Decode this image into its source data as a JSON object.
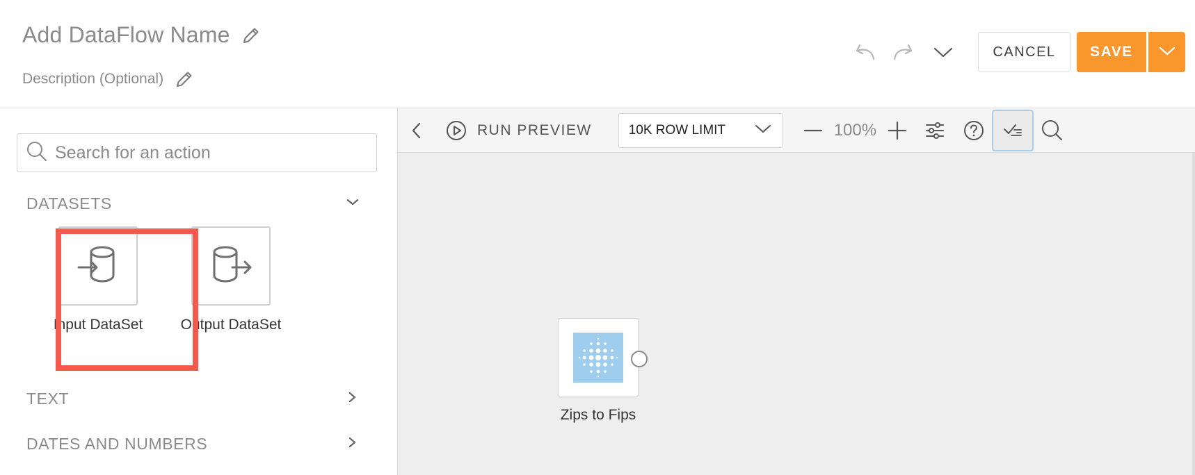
{
  "header": {
    "title": "Add DataFlow Name",
    "description": "Description (Optional)",
    "cancel_label": "CANCEL",
    "save_label": "SAVE"
  },
  "sidebar": {
    "search_placeholder": "Search for an action",
    "sections": [
      {
        "title": "DATASETS",
        "expanded": true
      },
      {
        "title": "TEXT",
        "expanded": false
      },
      {
        "title": "DATES AND NUMBERS",
        "expanded": false
      }
    ],
    "tiles": [
      {
        "label": "Input DataSet",
        "icon": "database-input-icon",
        "highlighted": true
      },
      {
        "label": "Output DataSet",
        "icon": "database-output-icon",
        "highlighted": false
      }
    ]
  },
  "toolbar": {
    "run_preview_label": "RUN PREVIEW",
    "row_limit_label": "10K ROW LIMIT",
    "zoom_level": "100%"
  },
  "canvas": {
    "nodes": [
      {
        "label": "Zips to Fips",
        "icon": "dataset-dots-icon"
      }
    ]
  },
  "colors": {
    "accent": "#f9962c",
    "highlight": "#f15a4c",
    "node_image": "#9fcdee",
    "canvas_bg": "#eeeeee"
  }
}
